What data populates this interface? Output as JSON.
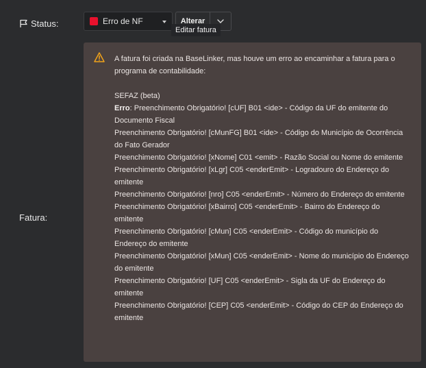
{
  "status": {
    "label": "Status:",
    "selected_value": "Erro de NF",
    "selected_color": "#e8112d",
    "change_button_label": "Alterar",
    "tooltip": "Editar fatura"
  },
  "fatura": {
    "label": "Fatura:",
    "message": {
      "intro": "A fatura foi criada na BaseLinker, mas houve um erro ao encaminhar a fatura para o programa de contabilidade:",
      "source": "SEFAZ (beta)",
      "error_prefix": "Erro",
      "lines": [
        ": Preenchimento Obrigatório! [cUF] B01 <ide> - Código da UF do emitente do Documento Fiscal",
        "Preenchimento Obrigatório! [cMunFG] B01 <ide> - Código do Município de Ocorrência do Fato Gerador",
        "Preenchimento Obrigatório! [xNome] C01 <emit> - Razão Social ou Nome do emitente",
        "Preenchimento Obrigatório! [xLgr] C05 <enderEmit> - Logradouro do Endereço do emitente",
        "Preenchimento Obrigatório! [nro] C05 <enderEmit> - Número do Endereço do emitente",
        "Preenchimento Obrigatório! [xBairro] C05 <enderEmit> - Bairro do Endereço do emitente",
        "Preenchimento Obrigatório! [cMun] C05 <enderEmit> - Código do município do Endereço do emitente",
        "Preenchimento Obrigatório! [xMun] C05 <enderEmit> - Nome do município do Endereço do emitente",
        "Preenchimento Obrigatório! [UF] C05 <enderEmit> - Sigla da UF do Endereço do emitente",
        "Preenchimento Obrigatório! [CEP] C05 <enderEmit> - Código do CEP do Endereço do emitente"
      ]
    }
  },
  "icons": {
    "status": "flag-icon",
    "dropdown": "caret-down-icon",
    "split_button": "chevron-down-icon",
    "alert": "warning-icon"
  }
}
